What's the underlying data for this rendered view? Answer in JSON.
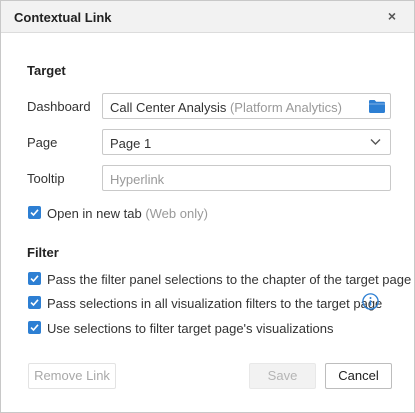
{
  "dialog": {
    "title": "Contextual Link",
    "close_glyph": "×"
  },
  "target": {
    "section_title": "Target",
    "dashboard": {
      "label": "Dashboard",
      "value": "Call Center Analysis",
      "suffix": "(Platform Analytics)",
      "browse_icon": "folder-icon"
    },
    "page": {
      "label": "Page",
      "value": "Page 1",
      "dropdown_icon": "chevron-down-icon"
    },
    "tooltip": {
      "label": "Tooltip",
      "placeholder": "Hyperlink"
    },
    "open_new_tab": {
      "label": "Open in new tab",
      "note": "(Web only)",
      "checked": true
    }
  },
  "filter": {
    "section_title": "Filter",
    "options": [
      {
        "label": "Pass the filter panel selections to the chapter of the target page",
        "checked": true
      },
      {
        "label": "Pass selections in all visualization filters to the target page",
        "checked": true,
        "info_icon": "info-icon"
      },
      {
        "label": "Use selections to filter target page's visualizations",
        "checked": true
      }
    ]
  },
  "buttons": {
    "remove_link": "Remove Link",
    "save": "Save",
    "cancel": "Cancel"
  },
  "colors": {
    "accent": "#2d7fd3",
    "folder": "#2d7fd3",
    "titlebar_bg": "#f2f2f2"
  }
}
